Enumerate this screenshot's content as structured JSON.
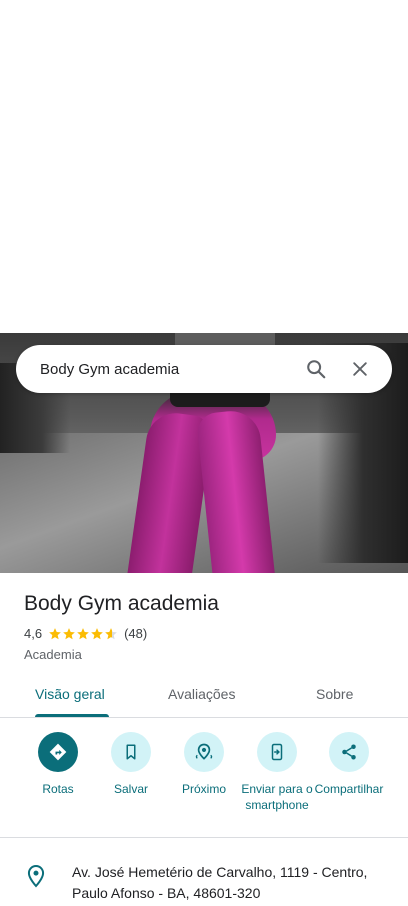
{
  "search": {
    "query": "Body Gym academia"
  },
  "place": {
    "name": "Body Gym academia",
    "rating": "4,6",
    "rating_value": 4.6,
    "review_count": "(48)",
    "category": "Academia"
  },
  "tabs": [
    {
      "label": "Visão geral",
      "active": true
    },
    {
      "label": "Avaliações",
      "active": false
    },
    {
      "label": "Sobre",
      "active": false
    }
  ],
  "actions": [
    {
      "label": "Rotas",
      "icon": "directions-icon"
    },
    {
      "label": "Salvar",
      "icon": "bookmark-icon"
    },
    {
      "label": "Próximo",
      "icon": "nearby-icon"
    },
    {
      "label": "Enviar para o smartphone",
      "icon": "send-to-phone-icon"
    },
    {
      "label": "Compartilhar",
      "icon": "share-icon"
    }
  ],
  "address": "Av. José Hemetério de Carvalho, 1119 - Centro, Paulo Afonso - BA, 48601-320",
  "colors": {
    "accent": "#0b6e7a",
    "accent_light": "#d2f3f7",
    "star": "#fbbc04"
  }
}
